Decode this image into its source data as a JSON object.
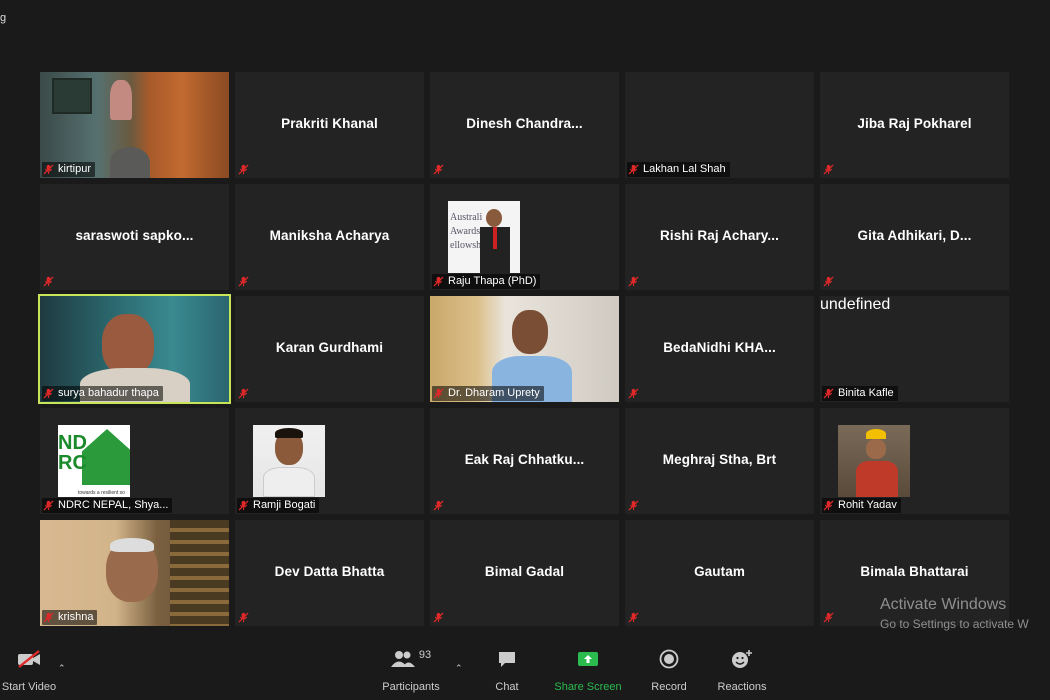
{
  "window": {
    "title": "g"
  },
  "participants": [
    {
      "name": "kirtipur",
      "type": "video"
    },
    {
      "name": "Prakriti Khanal",
      "type": "name"
    },
    {
      "name": "Dinesh  Chandra...",
      "type": "name"
    },
    {
      "name": "Lakhan Lal Shah",
      "type": "avatar"
    },
    {
      "name": "Jiba Raj Pokharel",
      "type": "name"
    },
    {
      "name": "saraswoti  sapko...",
      "type": "name"
    },
    {
      "name": "Maniksha Acharya",
      "type": "name"
    },
    {
      "name": "Raju Thapa (PhD)",
      "type": "avatar"
    },
    {
      "name": "Rishi  Raj  Achary...",
      "type": "name"
    },
    {
      "name": "Gita  Adhikari,  D...",
      "type": "name"
    },
    {
      "name": "surya bahadur thapa",
      "type": "video",
      "active": true
    },
    {
      "name": "Karan Gurdhami",
      "type": "name"
    },
    {
      "name": "Dr. Dharam Uprety",
      "type": "video"
    },
    {
      "name": "BedaNidhi  KHA...",
      "type": "name"
    },
    {
      "name": "Binita Kafle",
      "type": "video"
    },
    {
      "name": "NDRC NEPAL, Shya...",
      "type": "avatar"
    },
    {
      "name": "Ramji Bogati",
      "type": "avatar"
    },
    {
      "name": "Eak  Raj  Chhatku...",
      "type": "name"
    },
    {
      "name": "Meghraj Stha, Brt",
      "type": "name"
    },
    {
      "name": "Rohit Yadav",
      "type": "avatar"
    },
    {
      "name": "krishna",
      "type": "video"
    },
    {
      "name": "Dev Datta Bhatta",
      "type": "name"
    },
    {
      "name": "Bimal Gadal",
      "type": "name"
    },
    {
      "name": "Gautam",
      "type": "name"
    },
    {
      "name": "Bimala Bhattarai",
      "type": "name"
    }
  ],
  "avatar_texts": {
    "raju_award": [
      "Australi",
      "Awards",
      "ellowshi"
    ],
    "ndrc": [
      "ND",
      "RC",
      "towards a resilient so"
    ]
  },
  "watermark": {
    "line1": "Activate Windows",
    "line2": "Go to Settings to activate W"
  },
  "toolbar": {
    "start_video": "Start Video",
    "participants": "Participants",
    "participants_count": "93",
    "chat": "Chat",
    "share_screen": "Share Screen",
    "record": "Record",
    "reactions": "Reactions"
  },
  "colors": {
    "active_speaker": "#c8e55a",
    "share_green": "#2bbb4f",
    "muted_red": "#e02828"
  }
}
